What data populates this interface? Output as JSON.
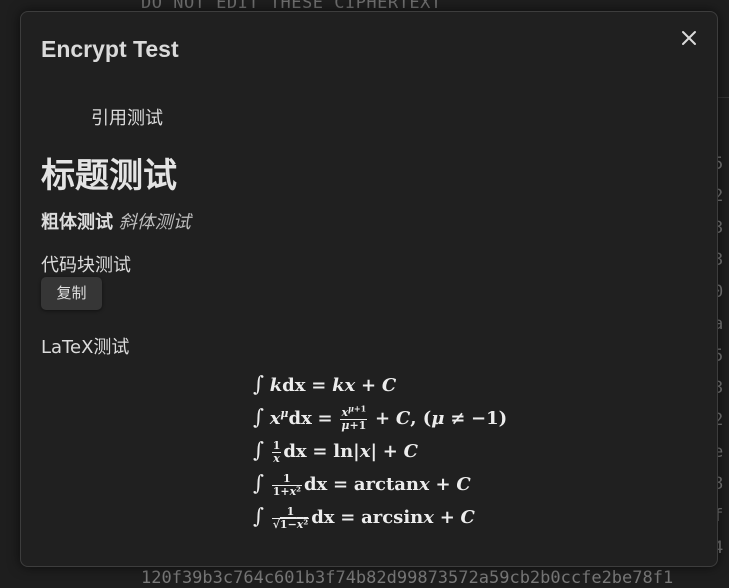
{
  "background": {
    "header_text": "DO NOT EDIT THESE CIPHERTEXT",
    "footer_text": "120f39b3c764c601b3f74b82d99873572a59cb2b0ccfe2be78f1",
    "right_chars": [
      "5",
      "2",
      "3",
      "3",
      "0",
      "a",
      "5",
      "3",
      "2",
      "e",
      "8",
      "f",
      "4"
    ]
  },
  "modal": {
    "title": "Encrypt Test",
    "close_symbol": "×"
  },
  "content": {
    "quote_text": "引用测试",
    "heading_text": "标题测试",
    "bold_text": "粗体测试",
    "italic_text": "斜体测试",
    "codeblock_label": "代码块测试",
    "copy_button_label": "复制",
    "latex_label": "LaTeX测试"
  },
  "math": {
    "line1": "∫ kdx = kx + C",
    "line2": "∫ xᵘdx = (x^(μ+1))/(μ+1) + C, (μ ≠ −1)",
    "line3": "∫ (1/x)dx = ln|x| + C",
    "line4": "∫ (1/(1+x²))dx = arctanx + C",
    "line5": "∫ (1/√(1−x²))dx = arcsinx + C"
  },
  "colors": {
    "page_background": "#1e1e1e",
    "modal_background": "#202020",
    "modal_border": "#3d3d3d",
    "text": "#dcddde",
    "button_background": "#363636"
  }
}
